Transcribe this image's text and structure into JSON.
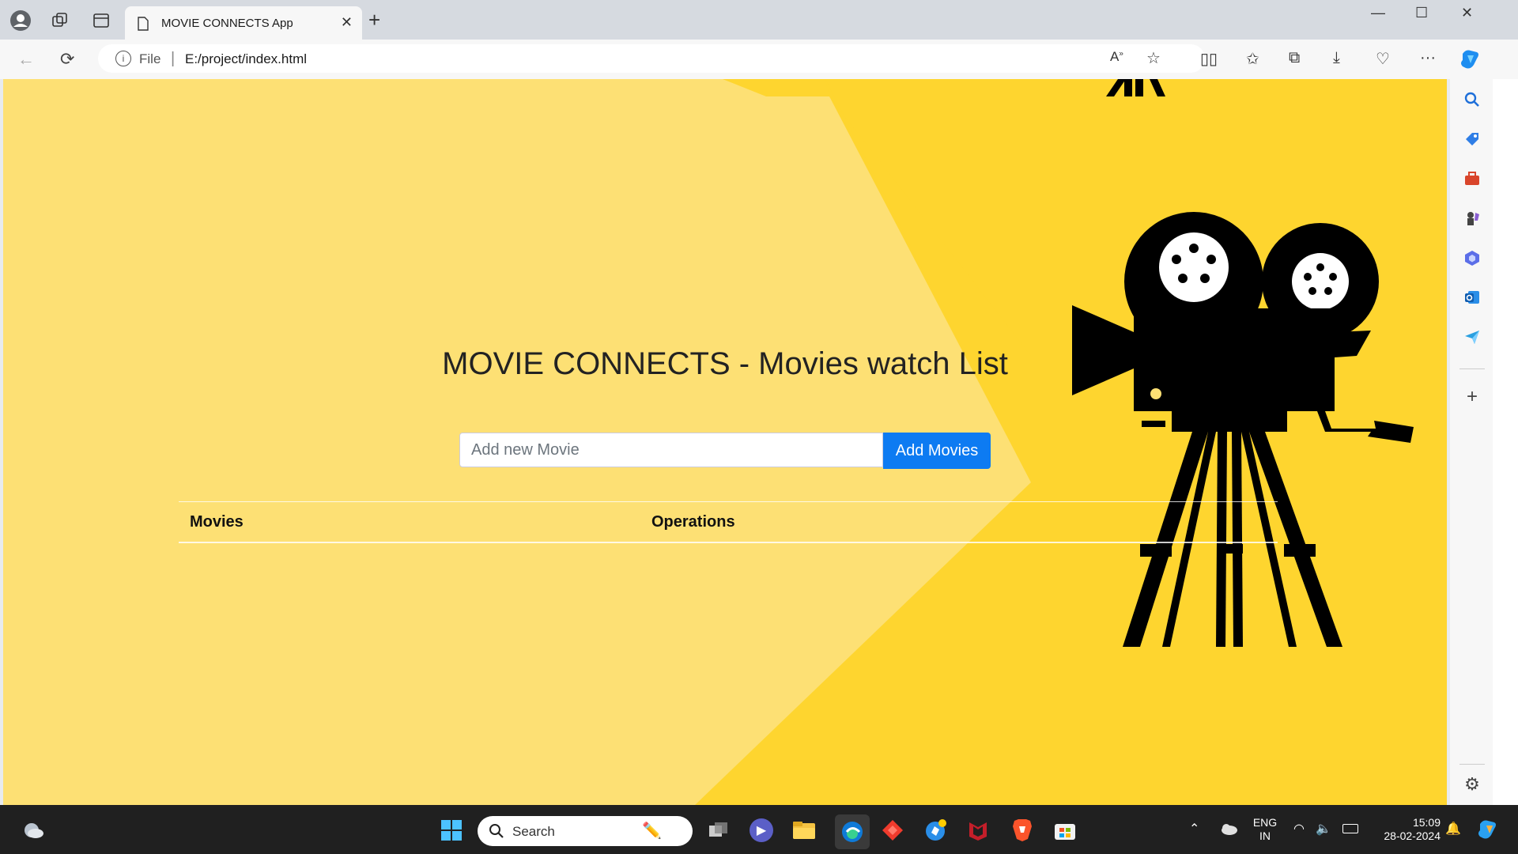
{
  "browser": {
    "tab_title": "MOVIE CONNECTS App",
    "address_scheme": "File",
    "url": "E:/project/index.html"
  },
  "page": {
    "title": "MOVIE CONNECTS - Movies watch List",
    "input_placeholder": "Add new Movie",
    "add_button": "Add Movies",
    "table_headers": [
      "Movies",
      "Operations"
    ]
  },
  "taskbar": {
    "search_label": "Search",
    "lang_line1": "ENG",
    "lang_line2": "IN",
    "time": "15:09",
    "date": "28-02-2024"
  },
  "colors": {
    "page_light_yellow": "#fde074",
    "page_dark_yellow": "#fed52f",
    "button_blue": "#0d7bf2",
    "taskbar_bg": "#202020"
  }
}
